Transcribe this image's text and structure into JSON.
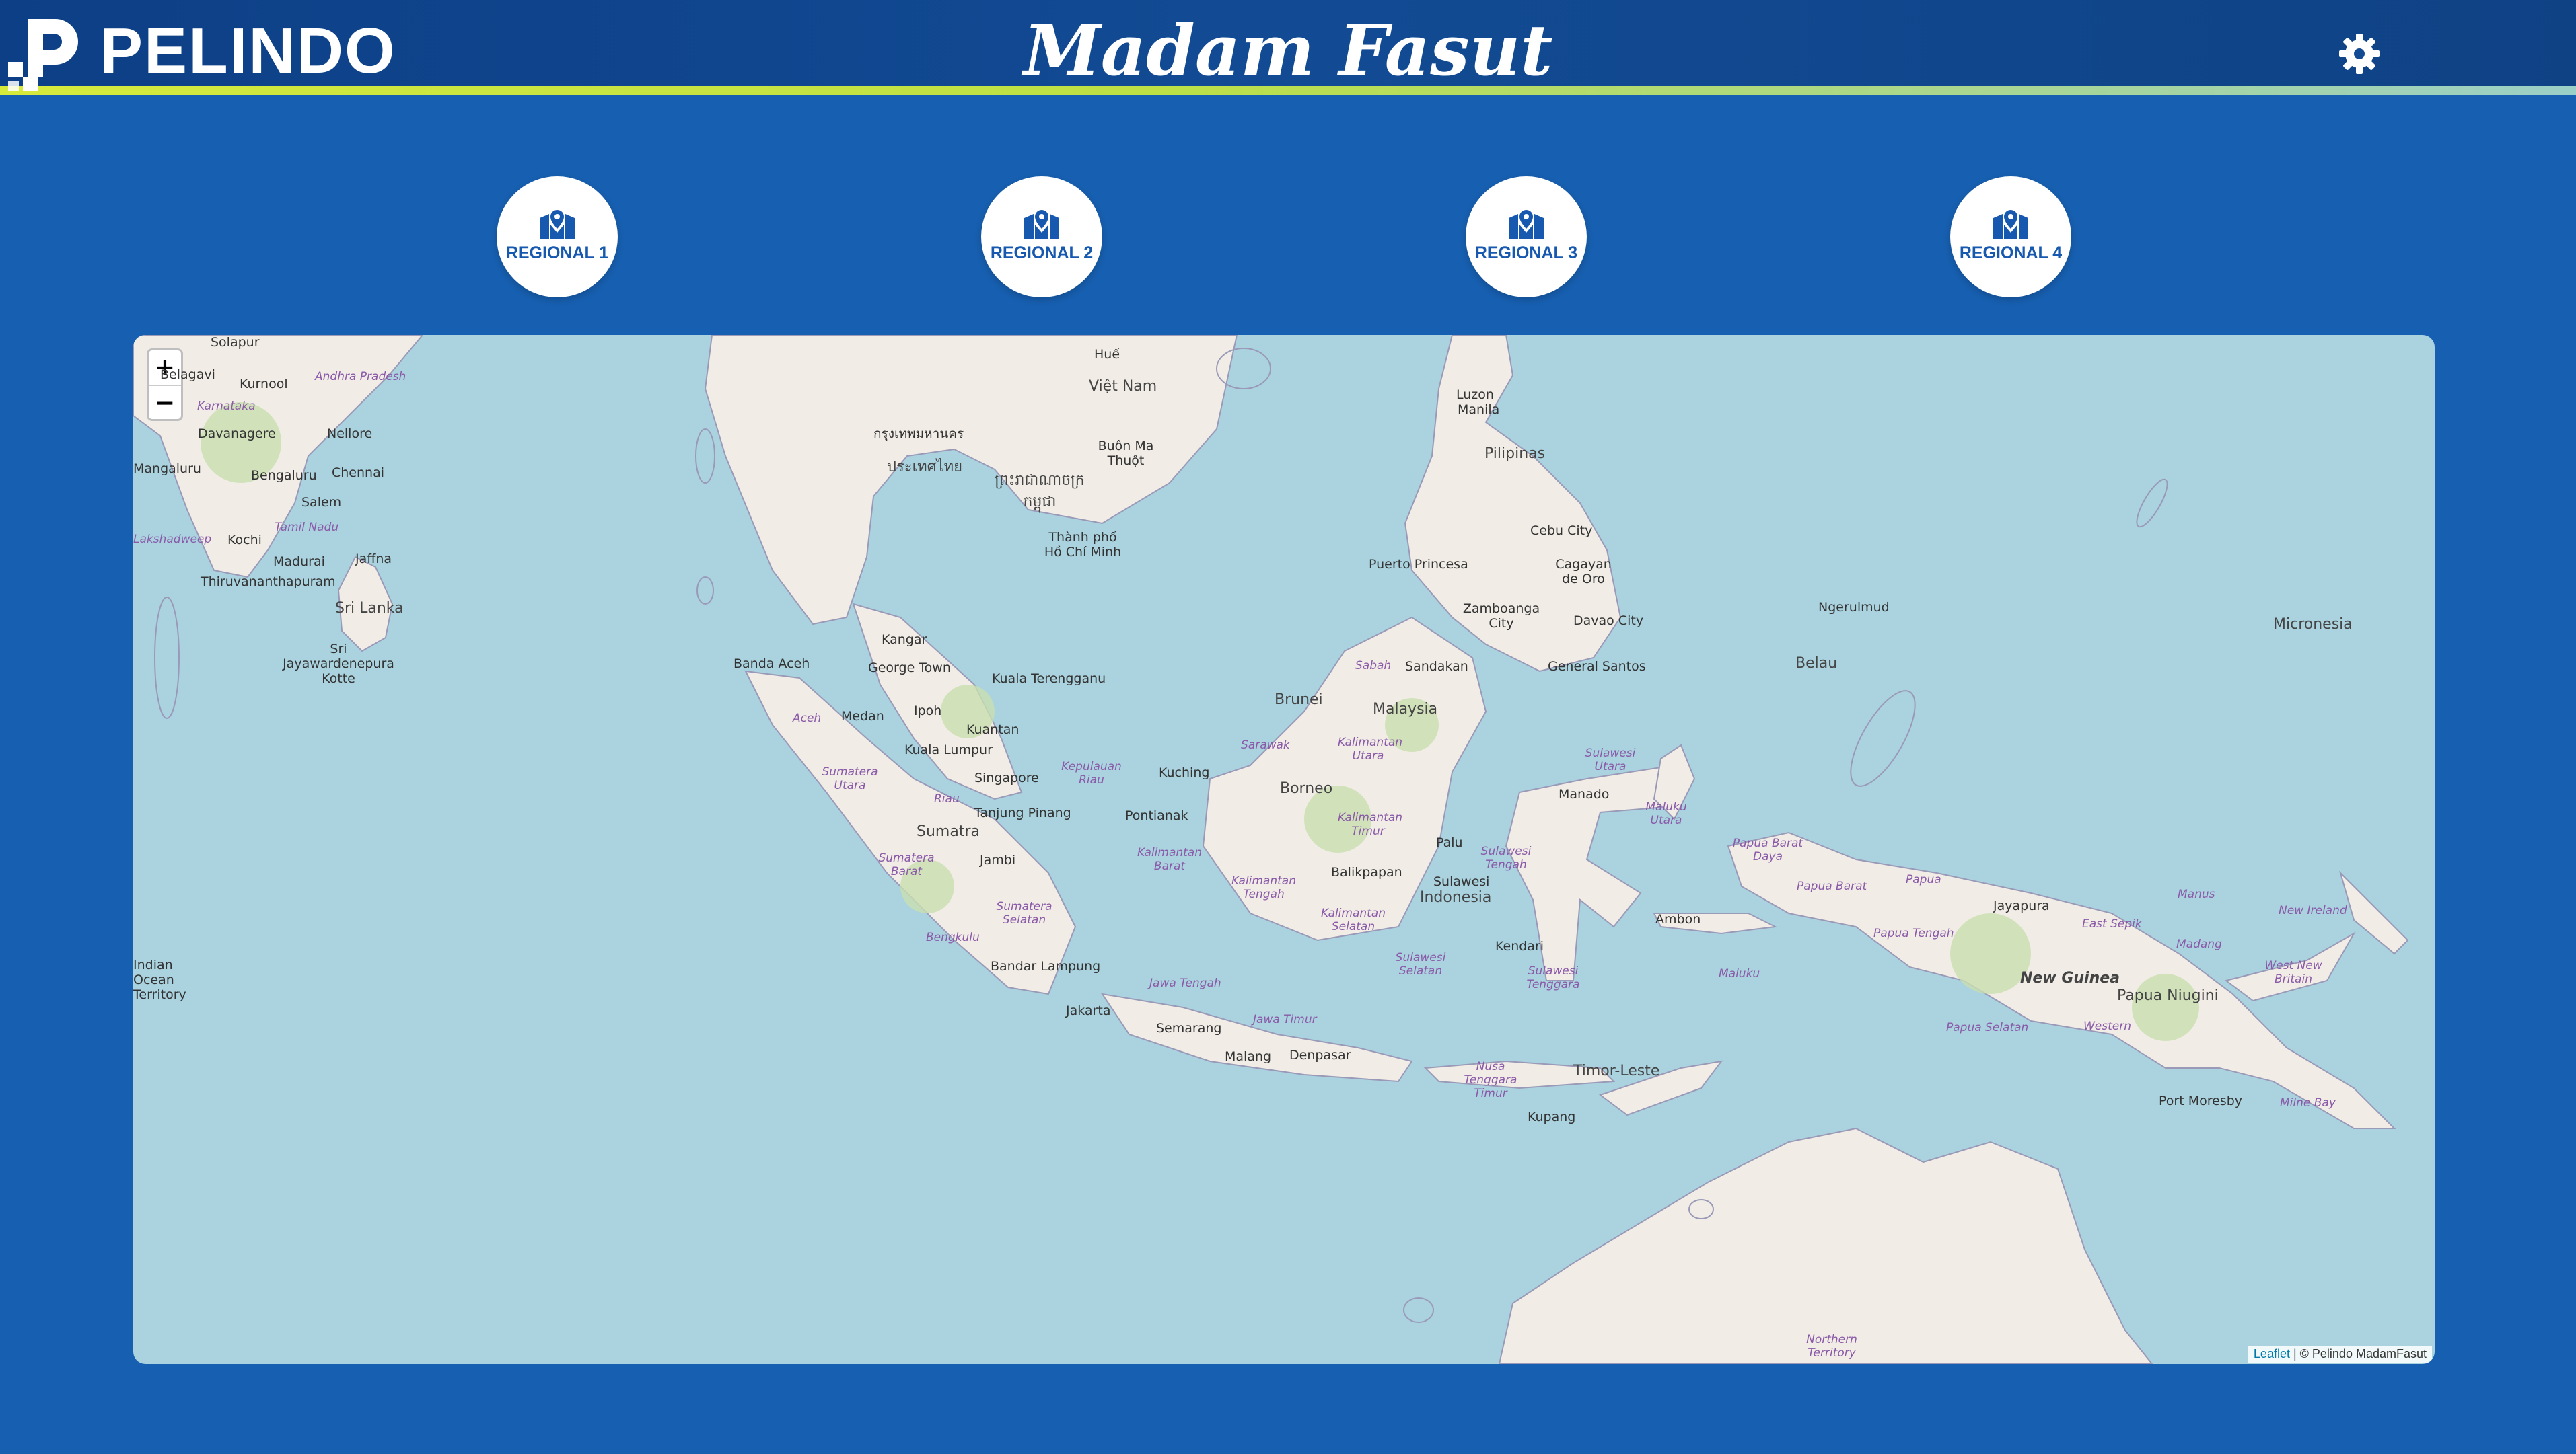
{
  "header": {
    "brand": "PELINDO",
    "title": "Madam Fasut",
    "settings_icon": "gear-icon"
  },
  "regionals": [
    {
      "label": "REGIONAL 1",
      "icon": "map-marker-icon"
    },
    {
      "label": "REGIONAL 2",
      "icon": "map-marker-icon"
    },
    {
      "label": "REGIONAL 3",
      "icon": "map-marker-icon"
    },
    {
      "label": "REGIONAL 4",
      "icon": "map-marker-icon"
    }
  ],
  "map": {
    "zoom_in": "+",
    "zoom_out": "−",
    "attribution_link": "Leaflet",
    "attribution_text": " | © Pelindo MadamFasut",
    "places": [
      {
        "name": "Solapur"
      },
      {
        "name": "Belagavi"
      },
      {
        "name": "Kurnool"
      },
      {
        "name": "Andhra Pradesh"
      },
      {
        "name": "Karnataka"
      },
      {
        "name": "Davanagere"
      },
      {
        "name": "Nellore"
      },
      {
        "name": "Mangaluru"
      },
      {
        "name": "Bengaluru"
      },
      {
        "name": "Chennai"
      },
      {
        "name": "Salem"
      },
      {
        "name": "Tamil Nadu"
      },
      {
        "name": "Lakshadweep"
      },
      {
        "name": "Kochi"
      },
      {
        "name": "Jaffna"
      },
      {
        "name": "Madurai"
      },
      {
        "name": "Thiruvananthapuram"
      },
      {
        "name": "Sri Lanka"
      },
      {
        "name": "Sri Jayawardenepura Kotte"
      },
      {
        "name": "Indian Ocean Territory"
      },
      {
        "name": "Huế"
      },
      {
        "name": "Việt Nam"
      },
      {
        "name": "กรุงเทพมหานคร"
      },
      {
        "name": "ประเทศไทย"
      },
      {
        "name": "Buôn Ma Thuột"
      },
      {
        "name": "ព្រះរាជាណាចក្រ កម្ពុជា"
      },
      {
        "name": "Thành phố Hồ Chí Minh"
      },
      {
        "name": "Luzon"
      },
      {
        "name": "Manila"
      },
      {
        "name": "Pilipinas"
      },
      {
        "name": "Cebu City"
      },
      {
        "name": "Puerto Princesa"
      },
      {
        "name": "Cagayan de Oro"
      },
      {
        "name": "Zamboanga City"
      },
      {
        "name": "Davao City"
      },
      {
        "name": "General Santos"
      },
      {
        "name": "Ngerulmud"
      },
      {
        "name": "Belau"
      },
      {
        "name": "Micronesia"
      },
      {
        "name": "Kangar"
      },
      {
        "name": "George Town"
      },
      {
        "name": "Banda Aceh"
      },
      {
        "name": "Kuala Terengganu"
      },
      {
        "name": "Sabah"
      },
      {
        "name": "Sandakan"
      },
      {
        "name": "Brunei"
      },
      {
        "name": "Malaysia"
      },
      {
        "name": "Medan"
      },
      {
        "name": "Aceh"
      },
      {
        "name": "Ipoh"
      },
      {
        "name": "Kuantan"
      },
      {
        "name": "Kuala Lumpur"
      },
      {
        "name": "Sarawak"
      },
      {
        "name": "Kalimantan Utara"
      },
      {
        "name": "Singapore"
      },
      {
        "name": "Kepulauan Riau"
      },
      {
        "name": "Kuching"
      },
      {
        "name": "Sumatera Utara"
      },
      {
        "name": "Riau"
      },
      {
        "name": "Tanjung Pinang"
      },
      {
        "name": "Borneo"
      },
      {
        "name": "Sulawesi Utara"
      },
      {
        "name": "Manado"
      },
      {
        "name": "Pontianak"
      },
      {
        "name": "Sumatra"
      },
      {
        "name": "Kalimantan Timur"
      },
      {
        "name": "Maluku Utara"
      },
      {
        "name": "Jambi"
      },
      {
        "name": "Kalimantan Barat"
      },
      {
        "name": "Palu"
      },
      {
        "name": "Sulawesi Tengah"
      },
      {
        "name": "Papua Barat Daya"
      },
      {
        "name": "Papua Barat"
      },
      {
        "name": "Papua"
      },
      {
        "name": "Jayapura"
      },
      {
        "name": "East Sepik"
      },
      {
        "name": "Manus"
      },
      {
        "name": "New Ireland"
      },
      {
        "name": "Sumatera Barat"
      },
      {
        "name": "Balikpapan"
      },
      {
        "name": "Kalimantan Tengah"
      },
      {
        "name": "Sulawesi"
      },
      {
        "name": "Indonesia"
      },
      {
        "name": "Sumatera Selatan"
      },
      {
        "name": "Kalimantan Selatan"
      },
      {
        "name": "Ambon"
      },
      {
        "name": "Papua Tengah"
      },
      {
        "name": "Madang"
      },
      {
        "name": "Bengkulu"
      },
      {
        "name": "Kendari"
      },
      {
        "name": "Bandar Lampung"
      },
      {
        "name": "Sulawesi Selatan"
      },
      {
        "name": "Sulawesi Tenggara"
      },
      {
        "name": "Maluku"
      },
      {
        "name": "New Guinea"
      },
      {
        "name": "Papua Niugini"
      },
      {
        "name": "West New Britain"
      },
      {
        "name": "Jawa Tengah"
      },
      {
        "name": "Jakarta"
      },
      {
        "name": "Jawa Timur"
      },
      {
        "name": "Semarang"
      },
      {
        "name": "Papua Selatan"
      },
      {
        "name": "Western"
      },
      {
        "name": "Malang"
      },
      {
        "name": "Denpasar"
      },
      {
        "name": "Nusa Tenggara Timur"
      },
      {
        "name": "Timor-Leste"
      },
      {
        "name": "Port Moresby"
      },
      {
        "name": "Milne Bay"
      },
      {
        "name": "Kupang"
      },
      {
        "name": "Northern Territory"
      }
    ]
  }
}
